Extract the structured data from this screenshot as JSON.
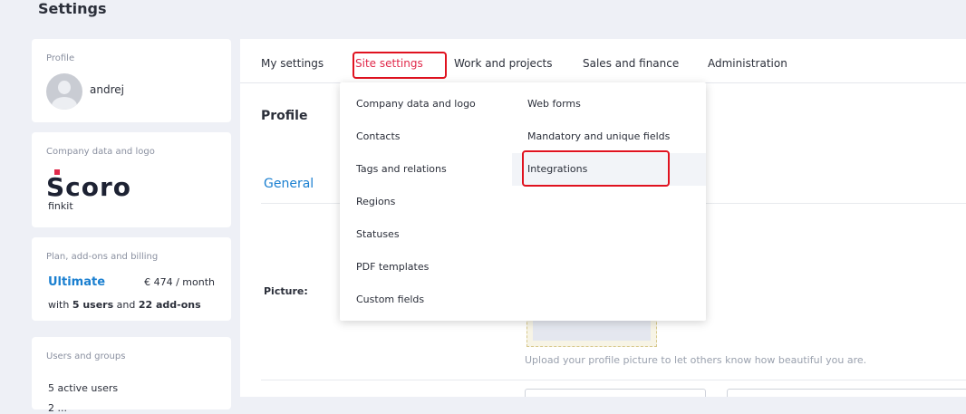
{
  "page": {
    "title": "Settings"
  },
  "sidebar": {
    "profile": {
      "label": "Profile",
      "username": "andrej"
    },
    "company": {
      "label": "Company data and logo",
      "logo_text": "Scoro",
      "name": "finkit"
    },
    "plan": {
      "label": "Plan, add-ons and billing",
      "name": "Ultimate",
      "price": "€ 474 / month",
      "desc_prefix": "with ",
      "users": "5 users",
      "desc_mid": " and ",
      "addons": "22 add-ons"
    },
    "users": {
      "label": "Users and groups",
      "active": "5 active users",
      "more": "2 ..."
    }
  },
  "tabs": [
    {
      "label": "My settings"
    },
    {
      "label": "Site settings"
    },
    {
      "label": "Work and projects"
    },
    {
      "label": "Sales and finance"
    },
    {
      "label": "Administration"
    }
  ],
  "content": {
    "section_title": "Profile",
    "general_tab": "General",
    "picture_label": "Picture:",
    "upload_hint": "Upload your profile picture to let others know how beautiful you are."
  },
  "dropdown": {
    "left": [
      "Company data and logo",
      "Contacts",
      "Tags and relations",
      "Regions",
      "Statuses",
      "PDF templates",
      "Custom fields"
    ],
    "right": [
      "Web forms",
      "Mandatory and unique fields",
      "Integrations"
    ]
  },
  "colors": {
    "accent": "#1a7fd0",
    "active_tab": "#e0294a",
    "highlight": "#e0121f",
    "logo_red": "#e0294a"
  }
}
